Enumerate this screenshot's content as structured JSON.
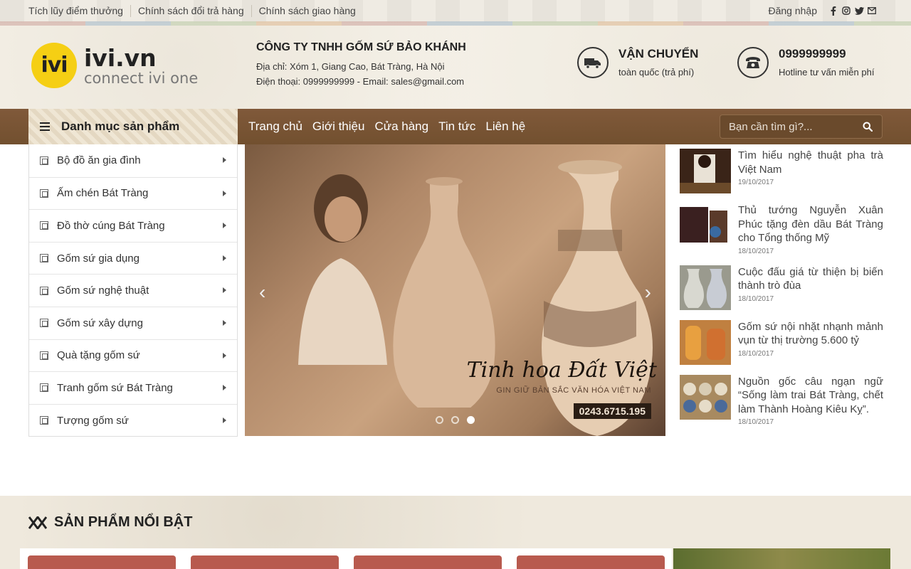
{
  "topbar": {
    "links": [
      "Tích lũy điểm thưởng",
      "Chính sách đổi trả hàng",
      "Chính sách giao hàng"
    ],
    "login": "Đăng nhập",
    "social_icons": [
      "facebook-icon",
      "instagram-icon",
      "twitter-icon",
      "email-icon"
    ]
  },
  "header": {
    "logo_mark": "ivi",
    "logo_name": "ivi.vn",
    "logo_tagline": "connect ivi one",
    "company_name": "CÔNG TY TNHH GỐM SỨ BẢO KHÁNH",
    "address": "Địa chỉ: Xóm 1, Giang Cao, Bát Tràng, Hà Nội",
    "contact": "Điện thoại: 0999999999 - Email: sales@gmail.com",
    "shipping_title": "VẬN CHUYỂN",
    "shipping_sub": "toàn quốc (trả phí)",
    "hotline_title": "0999999999",
    "hotline_sub": "Hotline tư vấn miễn phí"
  },
  "nav": {
    "category_heading": "Danh mục sản phẩm",
    "menu": [
      "Trang chủ",
      "Giới thiệu",
      "Cửa hàng",
      "Tin tức",
      "Liên hệ"
    ],
    "search_placeholder": "Bạn cần tìm gì?..."
  },
  "categories": [
    "Bộ đồ ăn gia đình",
    "Ấm chén Bát Tràng",
    "Đồ thờ cúng Bát Tràng",
    "Gốm sứ gia dụng",
    "Gốm sứ nghệ thuật",
    "Gốm sứ xây dựng",
    "Quà tặng gốm sứ",
    "Tranh gốm sứ Bát Tràng",
    "Tượng gốm sứ"
  ],
  "slider": {
    "headline": "Tinh hoa Đất Việt",
    "subline": "GIN GIỮ BẢN SẮC VĂN HÓA VIỆT NAM",
    "phone": "0243.6715.195",
    "active_slide": 3,
    "slide_count": 3
  },
  "news": [
    {
      "title": "Tìm hiểu nghệ thuật pha trà Việt Nam",
      "date": "19/10/2017"
    },
    {
      "title": "Thủ tướng Nguyễn Xuân Phúc tặng đèn dầu Bát Tràng cho Tổng thống Mỹ",
      "date": "18/10/2017"
    },
    {
      "title": "Cuộc đấu giá từ thiện bị biến thành trò đùa",
      "date": "18/10/2017"
    },
    {
      "title": "Gốm sứ nội nhặt nhạnh mảnh vụn từ thị trường 5.600 tỷ",
      "date": "18/10/2017"
    },
    {
      "title": "Nguồn gốc câu ngạn ngữ “Sống làm trai Bát Tràng, chết làm Thành Hoàng Kiêu Kỵ”.",
      "date": "18/10/2017"
    }
  ],
  "featured": {
    "title": "SẢN PHẨM NỔI BẬT"
  },
  "colors": {
    "nav_brown": "#7a5432",
    "logo_yellow": "#f5cf14",
    "page_bg": "#f3efe6"
  }
}
